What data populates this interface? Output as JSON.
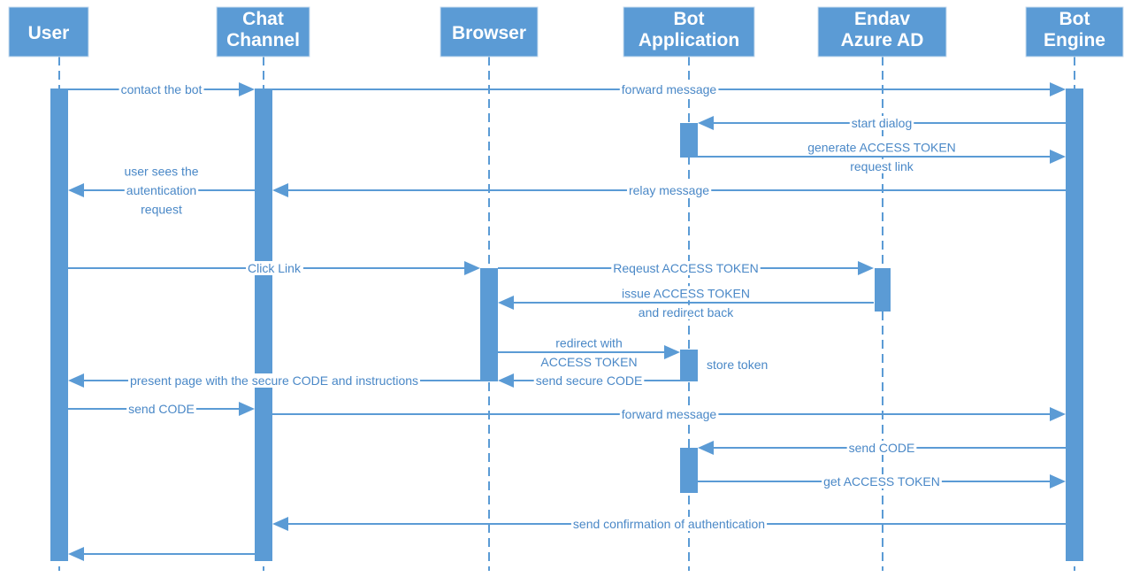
{
  "participants": [
    {
      "id": "user",
      "lines": [
        "User"
      ]
    },
    {
      "id": "chat",
      "lines": [
        "Chat",
        "Channel"
      ]
    },
    {
      "id": "browser",
      "lines": [
        "Browser"
      ]
    },
    {
      "id": "botapp",
      "lines": [
        "Bot",
        "Application"
      ]
    },
    {
      "id": "aad",
      "lines": [
        "Endav",
        "Azure AD"
      ]
    },
    {
      "id": "engine",
      "lines": [
        "Bot",
        "Engine"
      ]
    }
  ],
  "messages": [
    {
      "from": "user",
      "to": "chat",
      "lines": [
        "contact the bot"
      ]
    },
    {
      "from": "chat",
      "to": "engine",
      "lines": [
        "forward message"
      ]
    },
    {
      "from": "engine",
      "to": "botapp",
      "lines": [
        "start dialog"
      ]
    },
    {
      "from": "botapp",
      "to": "engine",
      "lines": [
        "generate ACCESS TOKEN",
        "request link"
      ]
    },
    {
      "from": "chat",
      "to": "user",
      "lines": [
        "user sees the",
        "autentication",
        "request"
      ]
    },
    {
      "from": "engine",
      "to": "chat",
      "lines": [
        "relay message"
      ]
    },
    {
      "from": "user",
      "to": "browser",
      "lines": [
        "Click Link"
      ]
    },
    {
      "from": "browser",
      "to": "aad",
      "lines": [
        "Reqeust ACCESS TOKEN"
      ]
    },
    {
      "from": "aad",
      "to": "browser",
      "lines": [
        "issue ACCESS TOKEN",
        "and redirect back"
      ]
    },
    {
      "from": "browser",
      "to": "botapp",
      "lines": [
        "redirect with",
        "ACCESS TOKEN"
      ]
    },
    {
      "from": "botapp",
      "to": "browser",
      "lines": [
        "send secure CODE"
      ]
    },
    {
      "from": "browser",
      "to": "user",
      "lines": [
        "present page with the secure CODE and instructions"
      ]
    },
    {
      "from": "user",
      "to": "chat",
      "lines": [
        "send CODE"
      ]
    },
    {
      "from": "chat",
      "to": "engine",
      "lines": [
        "forward message"
      ]
    },
    {
      "from": "engine",
      "to": "botapp",
      "lines": [
        "send CODE"
      ]
    },
    {
      "from": "botapp",
      "to": "engine",
      "lines": [
        "get ACCESS TOKEN"
      ]
    },
    {
      "from": "engine",
      "to": "chat",
      "lines": [
        "send confirmation of authentication"
      ]
    },
    {
      "from": "chat",
      "to": "user",
      "lines": []
    }
  ],
  "notes": [
    {
      "participant": "botapp",
      "text": "store token"
    }
  ],
  "colors": {
    "primary": "#5b9bd5",
    "label": "#4a88c7"
  }
}
